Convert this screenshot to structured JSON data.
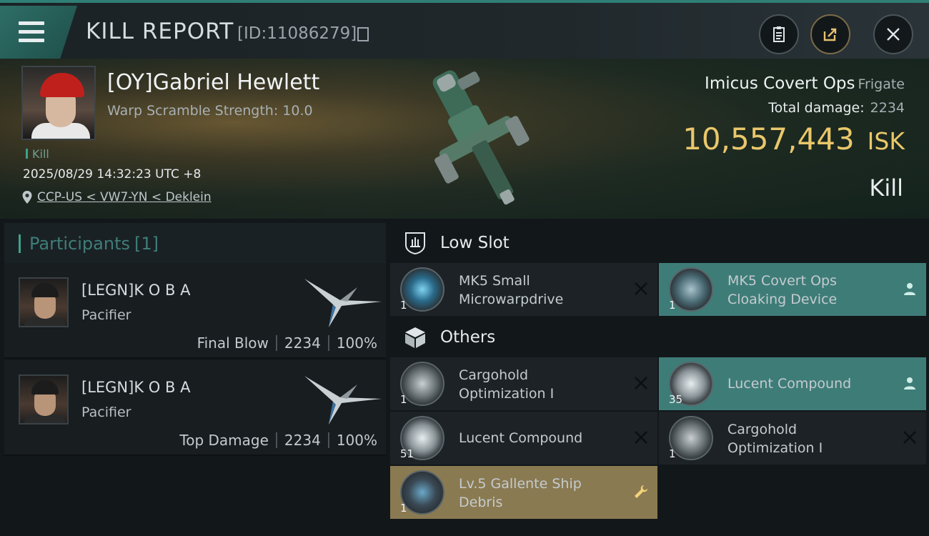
{
  "header": {
    "title": "KILL REPORT",
    "id_text": "[ID:11086279]"
  },
  "victim": {
    "name": "[OY]Gabriel Hewlett",
    "subtitle": "Warp Scramble Strength: 10.0",
    "kill_tag": "Kill",
    "timestamp": "2025/08/29 14:32:23 UTC +8",
    "location": "CCP-US < VW7-YN < Deklein",
    "ship_name": "Imicus Covert Ops",
    "ship_class": "Frigate",
    "total_damage_label": "Total damage:",
    "total_damage_value": "2234",
    "isk_value": "10,557,443",
    "isk_unit": "ISK",
    "result": "Kill"
  },
  "participants": {
    "title": "Participants",
    "count": "[1]",
    "rows": [
      {
        "name": "[LEGN]K O B A",
        "ship": "Pacifier",
        "role": "Final Blow",
        "damage": "2234",
        "percent": "100%"
      },
      {
        "name": "[LEGN]K O B A",
        "ship": "Pacifier",
        "role": "Top Damage",
        "damage": "2234",
        "percent": "100%"
      }
    ]
  },
  "sections": {
    "low_slot": "Low Slot",
    "others": "Others"
  },
  "low_slot_items": [
    {
      "qty": "1",
      "name_line1": "MK5 Small",
      "name_line2": "Microwarpdrive",
      "status": "destroyed",
      "icon": "microwarpdrive-icon"
    },
    {
      "qty": "1",
      "name_line1": "MK5 Covert Ops",
      "name_line2": "Cloaking Device",
      "status": "dropped",
      "icon": "cloaking-device-icon"
    }
  ],
  "other_items": [
    {
      "qty": "1",
      "name_line1": "Cargohold",
      "name_line2": "Optimization I",
      "status": "destroyed",
      "icon": "cargohold-icon"
    },
    {
      "qty": "35",
      "name_line1": "Lucent Compound",
      "name_line2": "",
      "status": "dropped",
      "icon": "crystal-icon"
    },
    {
      "qty": "51",
      "name_line1": "Lucent Compound",
      "name_line2": "",
      "status": "destroyed",
      "icon": "crystal-icon"
    },
    {
      "qty": "1",
      "name_line1": "Cargohold",
      "name_line2": "Optimization I",
      "status": "destroyed",
      "icon": "cargohold-icon"
    },
    {
      "qty": "1",
      "name_line1": "Lv.5 Gallente Ship",
      "name_line2": "Debris",
      "status": "salvage",
      "icon": "debris-icon"
    }
  ],
  "colors": {
    "accent_teal": "#3ea38c",
    "isk_gold": "#e9c76a",
    "dropped_bg": "#3e7c78",
    "salvage_bg": "#8a7a52"
  }
}
